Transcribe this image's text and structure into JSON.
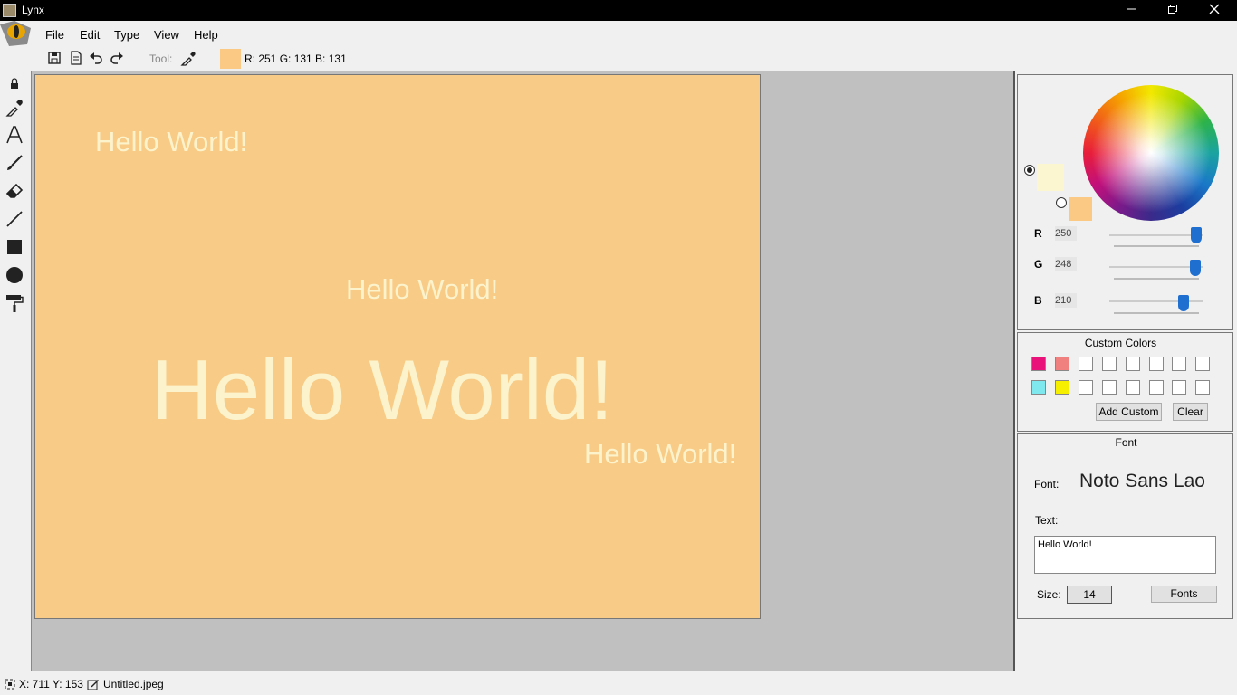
{
  "window": {
    "title": "Lynx"
  },
  "menu": {
    "file": "File",
    "edit": "Edit",
    "type": "Type",
    "view": "View",
    "help": "Help"
  },
  "toolbar": {
    "tool_label": "Tool:",
    "rgb_readout": "R: 251 G: 131 B: 131",
    "swatch_color": "#fbc983"
  },
  "canvas": {
    "background": "#f8cb86",
    "texts": [
      "Hello World!",
      "Hello World!",
      "Hello World!",
      "Hello World!"
    ],
    "text_color": "#fcf3cc"
  },
  "color_panel": {
    "primary_color": "#fbf6cf",
    "secondary_color": "#fbc983",
    "r_label": "R",
    "g_label": "G",
    "b_label": "B",
    "r": "250",
    "g": "248",
    "b": "210"
  },
  "custom_colors": {
    "title": "Custom Colors",
    "swatches": [
      "#e8127a",
      "#f08080",
      "#ffffff",
      "#ffffff",
      "#ffffff",
      "#ffffff",
      "#ffffff",
      "#ffffff",
      "#7fe8ee",
      "#f6f000",
      "#ffffff",
      "#ffffff",
      "#ffffff",
      "#ffffff",
      "#ffffff",
      "#ffffff"
    ],
    "add_custom": "Add Custom",
    "clear": "Clear"
  },
  "font_panel": {
    "title": "Font",
    "font_label": "Font:",
    "font_name": "Noto Sans Lao",
    "text_label": "Text:",
    "text_value": "Hello World!",
    "size_label": "Size:",
    "size_value": "14",
    "fonts_button": "Fonts"
  },
  "status": {
    "coords": "X: 711 Y: 153",
    "filename": "Untitled.jpeg"
  }
}
